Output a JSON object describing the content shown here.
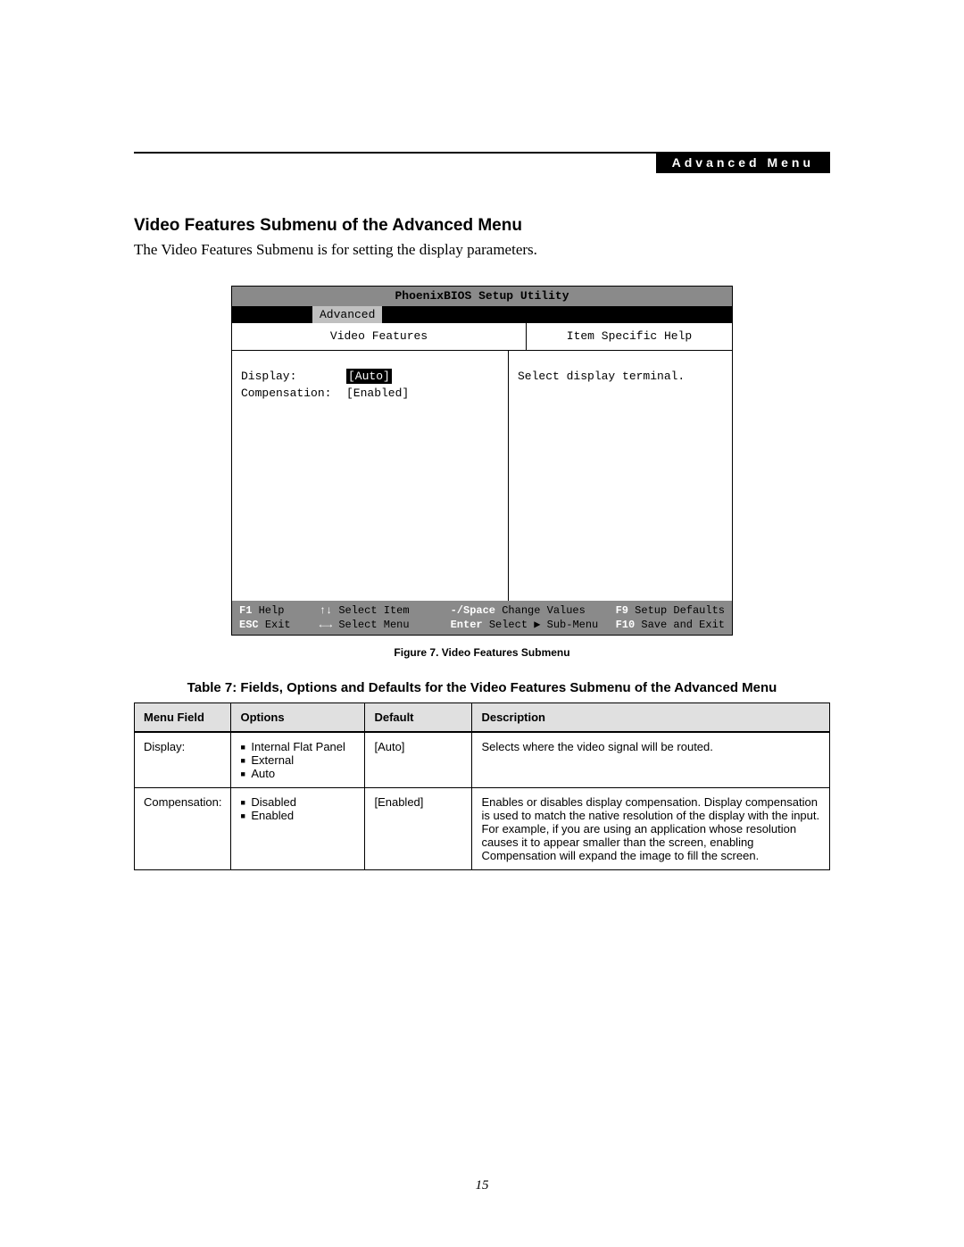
{
  "header": {
    "tag": "Advanced Menu"
  },
  "section": {
    "title": "Video Features Submenu of the Advanced Menu",
    "intro": "The Video Features Submenu is for setting the display parameters."
  },
  "bios": {
    "title": "PhoenixBIOS Setup Utility",
    "active_tab": "Advanced",
    "left_title": "Video Features",
    "right_title": "Item Specific Help",
    "fields": {
      "display": {
        "label": "Display:",
        "value": "[Auto]"
      },
      "compensation": {
        "label": "Compensation:",
        "value": "[Enabled]"
      }
    },
    "help_text": "Select display terminal.",
    "footer": {
      "row1": {
        "c1k": "F1",
        "c1v": "Help",
        "c2k": "↑↓",
        "c2v": "Select Item",
        "c3k": "-/Space",
        "c3v": "Change Values",
        "c4k": "F9",
        "c4v": "Setup Defaults"
      },
      "row2": {
        "c1k": "ESC",
        "c1v": "Exit",
        "c2k": "←→",
        "c2v": "Select Menu",
        "c3k": "Enter",
        "c3v": "Select ▶ Sub-Menu",
        "c4k": "F10",
        "c4v": "Save and Exit"
      }
    }
  },
  "figure_caption": "Figure 7.   Video Features Submenu",
  "table_caption": "Table 7: Fields, Options and Defaults for the Video Features Submenu of the Advanced Menu",
  "table": {
    "headers": {
      "menu_field": "Menu Field",
      "options": "Options",
      "default": "Default",
      "description": "Description"
    },
    "rows": [
      {
        "menu_field": "Display:",
        "options": [
          "Internal Flat Panel",
          "External",
          "Auto"
        ],
        "default": "[Auto]",
        "description": "Selects where the video signal will be routed."
      },
      {
        "menu_field": "Compensation:",
        "options": [
          "Disabled",
          "Enabled"
        ],
        "default": "[Enabled]",
        "description": "Enables or disables display compensation. Display compensation is used to match the native resolution of the display with the input. For example, if you are using an application whose resolution causes it to appear smaller than the screen, enabling Compensation will expand the image to fill the screen."
      }
    ]
  },
  "page_number": "15"
}
